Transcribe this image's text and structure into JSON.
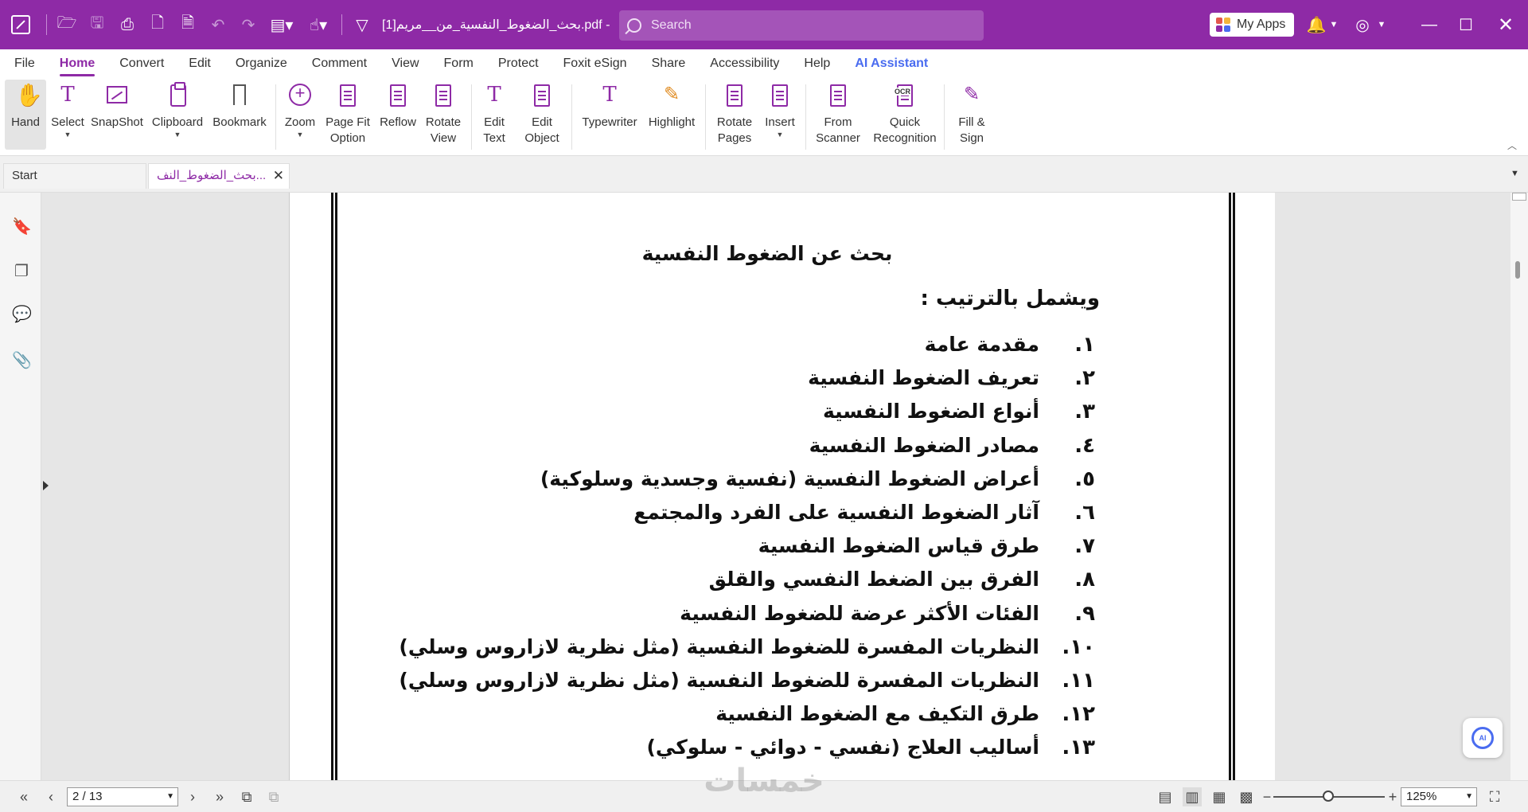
{
  "titlebar": {
    "doc_title": "بحث_الضغوط_النفسية_من__مريم[1].pdf - ...",
    "search_placeholder": "Search",
    "my_apps_label": "My Apps"
  },
  "menu": {
    "tabs": [
      "File",
      "Home",
      "Convert",
      "Edit",
      "Organize",
      "Comment",
      "View",
      "Form",
      "Protect",
      "Foxit eSign",
      "Share",
      "Accessibility",
      "Help",
      "AI Assistant"
    ],
    "active": "Home"
  },
  "ribbon": {
    "hand": "Hand",
    "select": "Select",
    "snapshot": "SnapShot",
    "clipboard": "Clipboard",
    "bookmark": "Bookmark",
    "zoom": "Zoom",
    "page_fit": "Page Fit\nOption",
    "reflow": "Reflow",
    "rotate_view": "Rotate\nView",
    "edit_text": "Edit\nText",
    "edit_object": "Edit\nObject",
    "typewriter": "Typewriter",
    "highlight": "Highlight",
    "rotate_pages": "Rotate\nPages",
    "insert": "Insert",
    "from_scanner": "From\nScanner",
    "quick_recognition": "Quick\nRecognition",
    "fill_sign": "Fill &\nSign",
    "ocr_badge": "OCR"
  },
  "tabs": {
    "start": "Start",
    "document": "بحث_الضغوط_النف..."
  },
  "document": {
    "heading": "بحث عن الضغوط النفسية",
    "intro": "ويشمل بالترتيب :",
    "items": [
      {
        "num": "١.",
        "text": "مقدمة عامة"
      },
      {
        "num": "٢.",
        "text": "تعريف الضغوط النفسية"
      },
      {
        "num": "٣.",
        "text": "أنواع الضغوط النفسية"
      },
      {
        "num": "٤.",
        "text": "مصادر الضغوط النفسية"
      },
      {
        "num": "٥.",
        "text": "أعراض الضغوط النفسية (نفسية وجسدية وسلوكية)"
      },
      {
        "num": "٦.",
        "text": "آثار الضغوط النفسية على الفرد والمجتمع"
      },
      {
        "num": "٧.",
        "text": "طرق قياس الضغوط النفسية"
      },
      {
        "num": "٨.",
        "text": "الفرق بين الضغط النفسي والقلق"
      },
      {
        "num": "٩.",
        "text": "الفئات الأكثر عرضة للضغوط النفسية"
      },
      {
        "num": "١٠.",
        "text": "النظريات المفسرة للضغوط النفسية (مثل نظرية لازاروس وسلي)"
      },
      {
        "num": "١١.",
        "text": "النظريات المفسرة للضغوط النفسية (مثل نظرية لازاروس وسلي)"
      },
      {
        "num": "١٢.",
        "text": "طرق التكيف مع الضغوط النفسية"
      },
      {
        "num": "١٣.",
        "text": "أساليب العلاج (نفسي - دوائي - سلوكي)"
      }
    ]
  },
  "status": {
    "page_indicator": "2 / 13",
    "zoom_level": "125%",
    "zoom_fraction": 0.49
  },
  "ai_badge": "AI",
  "watermark": "خمسات",
  "colors": {
    "brand": "#8e2aa6",
    "ai_accent": "#4a6cf0"
  }
}
